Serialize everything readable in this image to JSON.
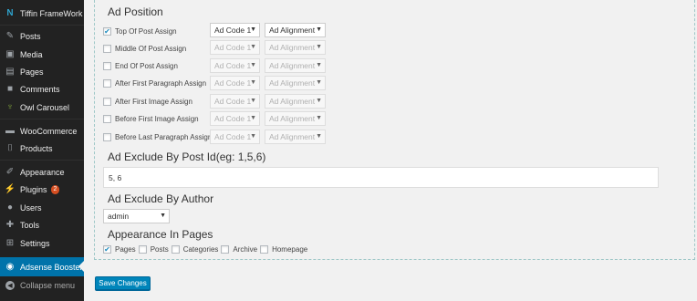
{
  "sidebar": {
    "brand": {
      "label": "Tiffin FrameWork",
      "icon": "tiffin-logo-icon"
    },
    "items": [
      {
        "label": "Posts",
        "icon": "pushpin-icon"
      },
      {
        "label": "Media",
        "icon": "media-icon"
      },
      {
        "label": "Pages",
        "icon": "pages-icon"
      },
      {
        "label": "Comments",
        "icon": "comments-icon"
      },
      {
        "label": "Owl Carousel",
        "icon": "owl-icon"
      },
      {
        "label": "WooCommerce",
        "icon": "woocommerce-icon"
      },
      {
        "label": "Products",
        "icon": "products-icon"
      },
      {
        "label": "Appearance",
        "icon": "paintbrush-icon"
      },
      {
        "label": "Plugins",
        "icon": "plugin-icon",
        "badge": "2"
      },
      {
        "label": "Users",
        "icon": "users-icon"
      },
      {
        "label": "Tools",
        "icon": "wrench-icon"
      },
      {
        "label": "Settings",
        "icon": "settings-icon"
      },
      {
        "label": "Adsense Booster",
        "icon": "adsense-icon",
        "active": true
      }
    ],
    "collapse_label": "Collapse menu"
  },
  "ad_position": {
    "heading": "Ad Position",
    "rows": [
      {
        "label": "Top Of Post Assign",
        "checked": true,
        "code": "Ad Code 1",
        "align": "Ad Alignment",
        "enabled": true
      },
      {
        "label": "Middle Of Post Assign",
        "checked": false,
        "code": "Ad Code 1",
        "align": "Ad Alignment",
        "enabled": false
      },
      {
        "label": "End Of Post Assign",
        "checked": false,
        "code": "Ad Code 1",
        "align": "Ad Alignment",
        "enabled": false
      },
      {
        "label": "After First Paragraph Assign",
        "checked": false,
        "code": "Ad Code 1",
        "align": "Ad Alignment",
        "enabled": false
      },
      {
        "label": "After First Image Assign",
        "checked": false,
        "code": "Ad Code 1",
        "align": "Ad Alignment",
        "enabled": false
      },
      {
        "label": "Before First Image Assign",
        "checked": false,
        "code": "Ad Code 1",
        "align": "Ad Alignment",
        "enabled": false
      },
      {
        "label": "Before Last Paragraph Assign",
        "checked": false,
        "code": "Ad Code 1",
        "align": "Ad Alignment",
        "enabled": false
      }
    ]
  },
  "exclude_post": {
    "heading": "Ad Exclude By Post Id(eg: 1,5,6)",
    "value": "5, 6"
  },
  "exclude_author": {
    "heading": "Ad Exclude By Author",
    "selected": "admin"
  },
  "appearance_pages": {
    "heading": "Appearance In Pages",
    "options": [
      {
        "label": "Pages",
        "checked": true
      },
      {
        "label": "Posts",
        "checked": false
      },
      {
        "label": "Categories",
        "checked": false
      },
      {
        "label": "Archive",
        "checked": false
      },
      {
        "label": "Homepage",
        "checked": false
      }
    ]
  },
  "save_label": "Save Changes",
  "colors": {
    "sidebar_bg": "#222222",
    "active": "#0073aa",
    "button": "#0085ba",
    "badge": "#d54e21"
  }
}
